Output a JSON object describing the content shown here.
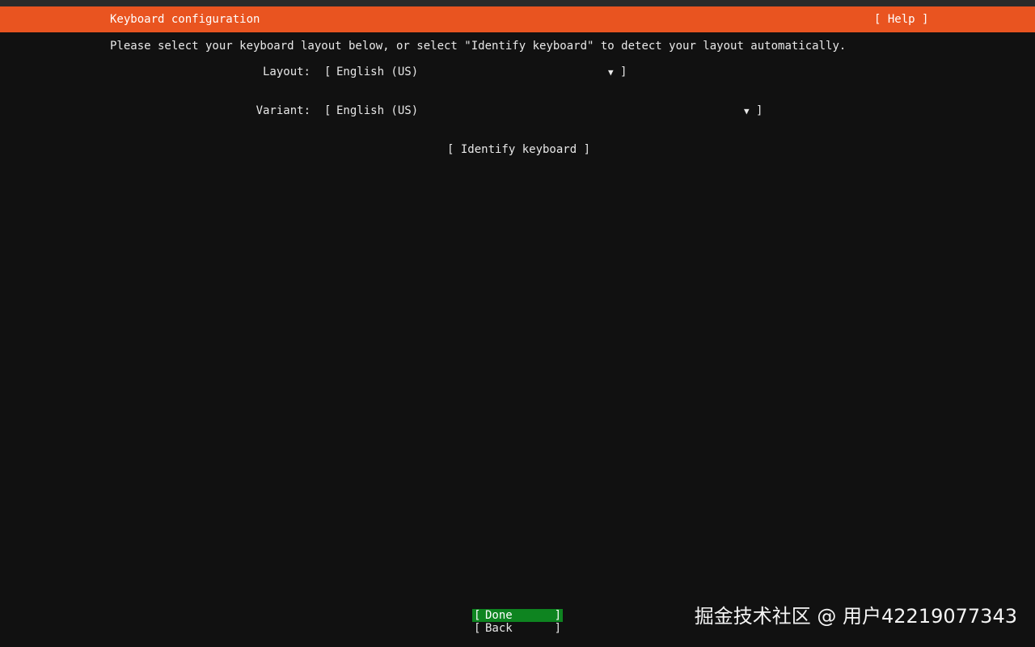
{
  "header": {
    "title": "Keyboard configuration",
    "help_label": "[ Help ]",
    "background_color": "#e95420"
  },
  "instructions": "Please select your keyboard layout below, or select \"Identify keyboard\" to detect your layout automatically.",
  "layout": {
    "label": "Layout:",
    "open_bracket": "[",
    "value": "English (US)",
    "arrow": "▼",
    "close_bracket": "]"
  },
  "variant": {
    "label": "Variant:",
    "open_bracket": "[",
    "value": "English (US)",
    "arrow": "▼",
    "close_bracket": "]"
  },
  "identify_button": "[ Identify keyboard ]",
  "footer": {
    "done": {
      "open": "[",
      "label": "Done",
      "close": "]",
      "highlight_color": "#0e8420"
    },
    "back": {
      "open": "[",
      "label": "Back",
      "close": "]"
    }
  },
  "watermark": "掘金技术社区 @ 用户42219077343"
}
